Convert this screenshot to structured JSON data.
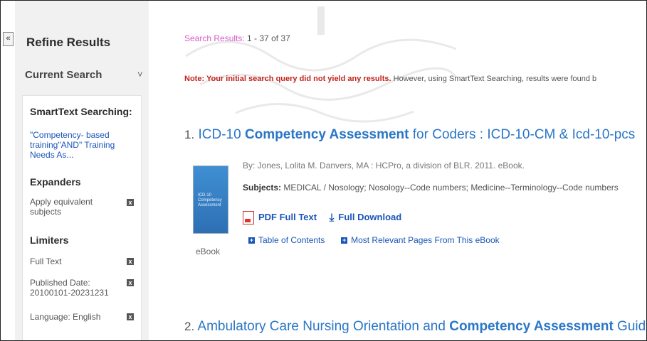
{
  "sidebar": {
    "collapse_icon": "double-chevron-left",
    "collapse_label": "«",
    "title": "Refine Results",
    "current_search": "Current Search",
    "current_search_chevron": "˅",
    "smarttext_heading": "SmartText Searching:",
    "smarttext_query": "\"Competency- based training\"AND\" Training Needs As...",
    "expanders_heading": "Expanders",
    "expanders": [
      {
        "label": "Apply equivalent subjects"
      }
    ],
    "limiters_heading": "Limiters",
    "limiters": [
      {
        "label": "Full Text"
      },
      {
        "label": "Published Date: 20100101-20231231"
      },
      {
        "label": "Language: English"
      }
    ],
    "remove_glyph": "x"
  },
  "results": {
    "count_label": "Search Results:",
    "count_value": "1 - 37 of 37",
    "note_bold": "Note: Your initial search query did not yield any results.",
    "note_rest": " However, using SmartText Searching, results were found b",
    "items": [
      {
        "number": "1.",
        "title_pre": "ICD-10 ",
        "title_bold": "Competency Assessment",
        "title_post": " for Coders : ICD-10-CM & Icd-10-pcs",
        "byline": "By: Jones, Lolita M. Danvers, MA : HCPro, a division of BLR. 2011. eBook.",
        "subjects_label": "Subjects:",
        "subjects_value": " MEDICAL / Nosology; Nosology--Code numbers; Medicine--Terminology--Code numbers",
        "pdf_link": "PDF Full Text",
        "download_link": "Full Download",
        "toc_link": "Table of Contents",
        "relevant_link": "Most Relevant Pages From This eBook",
        "format_label": "eBook",
        "cover_text": "ICD-10 Competency Assessment"
      },
      {
        "number": "2.",
        "title_pre": "Ambulatory Care Nursing Orientation and ",
        "title_bold": "Competency Assessment",
        "title_post": " Guide"
      }
    ]
  },
  "colors": {
    "accent_link": "#2a76c6",
    "count_pink": "#d65bc7",
    "note_red": "#c2221c",
    "sidebar_bg": "#f1f1f1"
  }
}
